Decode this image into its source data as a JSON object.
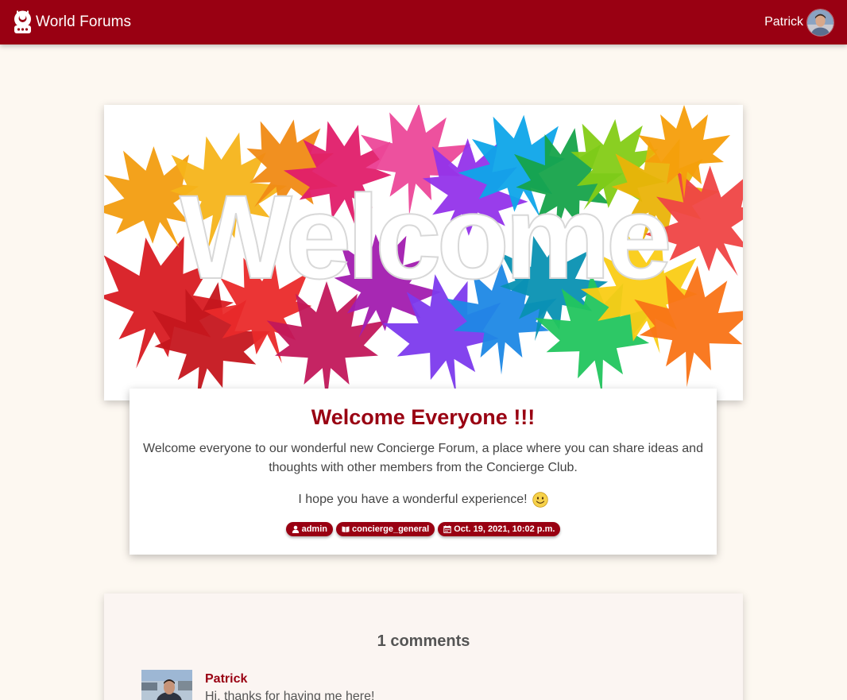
{
  "navbar": {
    "brand_title": "World Forums",
    "brand_icon": "robot-logo-icon",
    "user_name": "Patrick",
    "avatar_icon": "user-avatar"
  },
  "hero": {
    "image_text": "Welcome",
    "image_desc": "colorful maple leaves"
  },
  "post": {
    "title": "Welcome Everyone !!!",
    "body": "Welcome everyone to our wonderful new Concierge Forum, a place where you can share ideas and thoughts with other members from the Concierge Club.",
    "body2": "I hope you have a wonderful experience!",
    "tags": {
      "author": "admin",
      "category": "concierge_general",
      "date": "Oct. 19, 2021, 10:02 p.m."
    }
  },
  "comments": {
    "title": "1 comments",
    "items": [
      {
        "author": "Patrick",
        "text": "Hi, thanks for having me here!"
      }
    ]
  },
  "colors": {
    "brand": "#990012",
    "background": "#fdf8f1",
    "card": "#ffffff"
  }
}
